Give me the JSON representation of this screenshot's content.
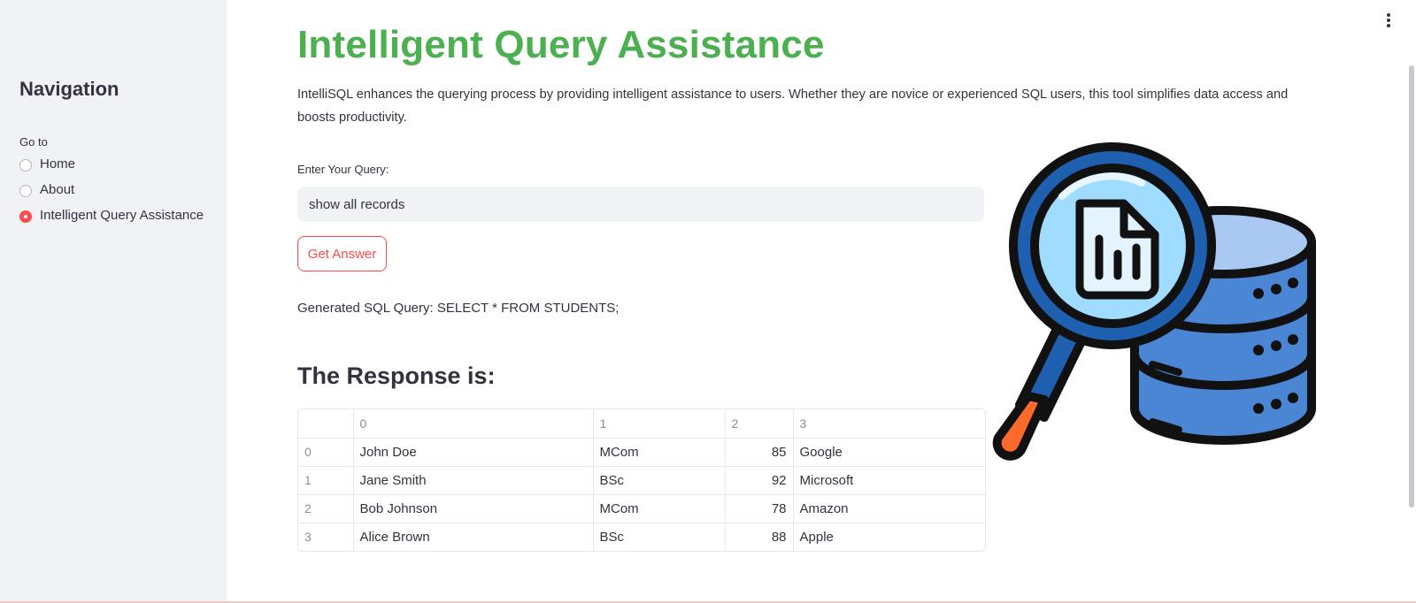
{
  "sidebar": {
    "title": "Navigation",
    "radio_label": "Go to",
    "options": [
      {
        "label": "Home",
        "selected": false
      },
      {
        "label": "About",
        "selected": false
      },
      {
        "label": "Intelligent Query Assistance",
        "selected": true
      }
    ]
  },
  "main": {
    "title": "Intelligent Query Assistance",
    "description": "IntelliSQL enhances the querying process by providing intelligent assistance to users. Whether they are novice or experienced SQL users, this tool simplifies data access and boosts productivity.",
    "query_label": "Enter Your Query:",
    "query_value": "show all records",
    "button_label": "Get Answer",
    "generated_sql": "Generated SQL Query: SELECT * FROM STUDENTS;",
    "response_heading": "The Response is:"
  },
  "table": {
    "columns": [
      "",
      "0",
      "1",
      "2",
      "3"
    ],
    "rows": [
      {
        "index": "0",
        "c0": "John Doe",
        "c1": "MCom",
        "c2": "85",
        "c3": "Google"
      },
      {
        "index": "1",
        "c0": "Jane Smith",
        "c1": "BSc",
        "c2": "92",
        "c3": "Microsoft"
      },
      {
        "index": "2",
        "c0": "Bob Johnson",
        "c1": "MCom",
        "c2": "78",
        "c3": "Amazon"
      },
      {
        "index": "3",
        "c0": "Alice Brown",
        "c1": "BSc",
        "c2": "88",
        "c3": "Apple"
      }
    ]
  },
  "colors": {
    "title_green": "#4caf50",
    "accent_red": "#ff4b4b",
    "sidebar_bg": "#f0f2f6"
  },
  "icons": {
    "illustration": "magnifier-database-icon",
    "menu": "kebab-menu-icon"
  }
}
